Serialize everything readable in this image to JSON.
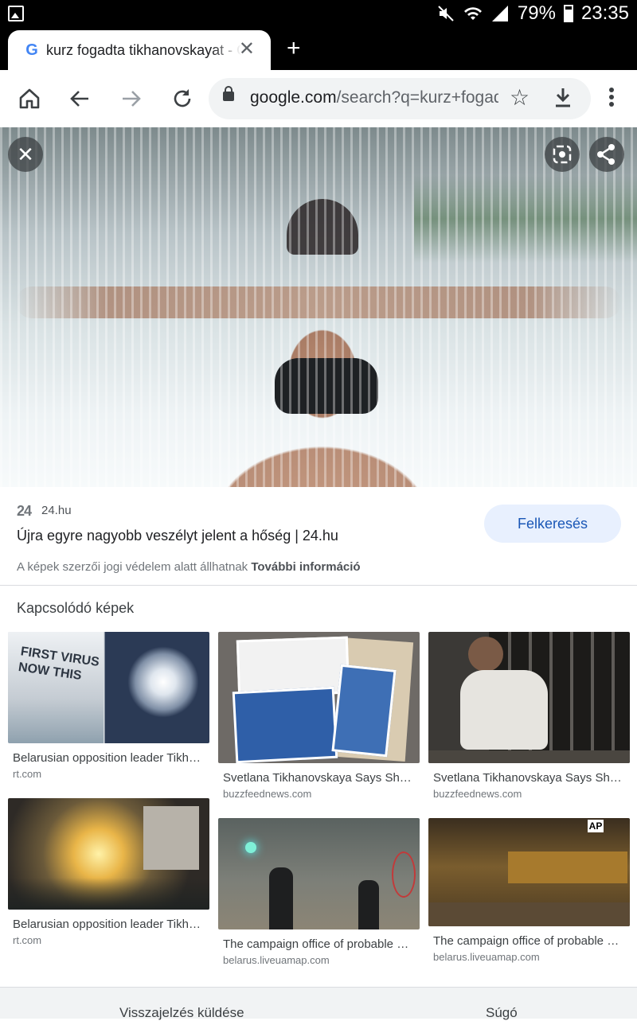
{
  "status_bar": {
    "battery": "79%",
    "time": "23:35",
    "battery_level": 0.79
  },
  "tab": {
    "title": "kurz fogadta tikhanovskayat - Google Keresés",
    "close_glyph": "✕",
    "favicon": "G"
  },
  "toolbar": {
    "url_host": "google.com",
    "url_path": "/search?q=kurz+fogadta+tikhanovskayat"
  },
  "image_viewer": {
    "source_name": "24.hu",
    "source_logo": "24",
    "title": "Újra egyre nagyobb veszélyt jelent a hőség | 24.hu",
    "visit_button": "Felkeresés",
    "copyright_text": "A képek szerzői jogi védelem alatt állhatnak",
    "copyright_link": "További információ"
  },
  "related": {
    "heading": "Kapcsolódó képek",
    "cards": [
      {
        "title": "Belarusian opposition leader Tikhanovskaya...",
        "domain": "rt.com",
        "sign_text": "FIRST VIRUS NOW THIS"
      },
      {
        "title": "Svetlana Tikhanovskaya Says She ...",
        "domain": "buzzfeednews.com"
      },
      {
        "title": "Svetlana Tikhanovskaya Says She ...",
        "domain": "buzzfeednews.com"
      },
      {
        "title": "Belarusian opposition leader Tikhanovskaya...",
        "domain": "rt.com"
      },
      {
        "title": "The campaign office of probable presidential...",
        "domain": "belarus.liveuamap.com"
      },
      {
        "title": "The campaign office of probable presidential...",
        "domain": "belarus.liveuamap.com",
        "badge": "AP"
      }
    ]
  },
  "footer": {
    "feedback": "Visszajelzés küldése",
    "help": "Súgó"
  },
  "colors": {
    "accent": "#1a57b6",
    "visit_bg": "#e8f0fe",
    "status_bar": "#000000"
  }
}
